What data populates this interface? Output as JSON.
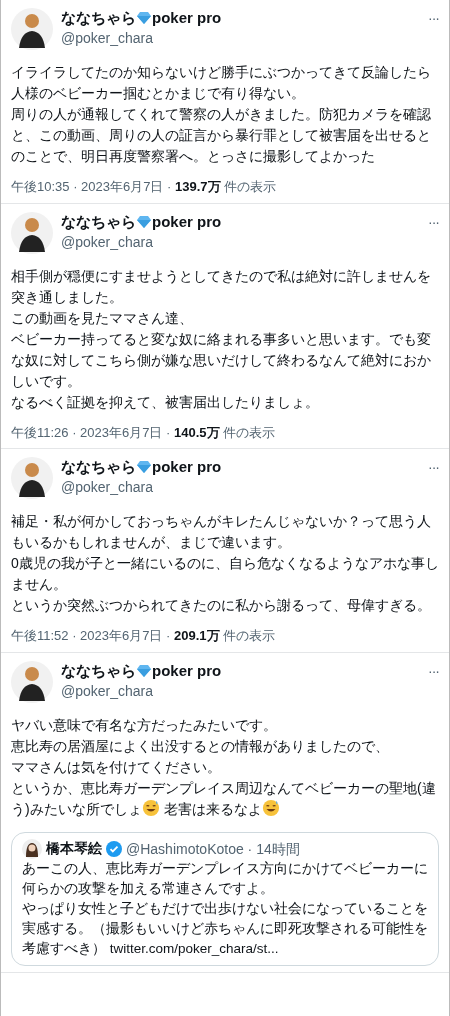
{
  "tweets": [
    {
      "name": "ななちゃら",
      "name_suffix": "poker pro",
      "handle": "@poker_chara",
      "more": "···",
      "paragraphs": [
        {
          "kind": "text",
          "text": "イライラしてたのか知らないけど勝手にぶつかってきて反論したら人様のベビーカー掴むとかまじで有り得ない。"
        },
        {
          "kind": "text",
          "text": "周りの人が通報してくれて警察の人がきました。防犯カメラを確認と、この動画、周りの人の証言から暴行罪として被害届を出せるとのことで、明日再度警察署へ。とっさに撮影してよかった"
        }
      ],
      "meta": "午後10:35 · 2023年6月7日 · **139.7万** 件の表示"
    },
    {
      "name": "ななちゃら",
      "name_suffix": "poker pro",
      "handle": "@poker_chara",
      "more": "···",
      "paragraphs": [
        {
          "kind": "text",
          "text": "相手側が穏便にすませようとしてきたので私は絶対に許しませんを突き通しました。"
        },
        {
          "kind": "text",
          "text": "この動画を見たママさん達、"
        },
        {
          "kind": "text",
          "text": "ベビーカー持ってると変な奴に絡まれる事多いと思います。でも変な奴に対してこちら側が嫌な思いだけして終わるなんて絶対におかしいです。"
        },
        {
          "kind": "text",
          "text": "なるべく証拠を抑えて、被害届出したりましょ。"
        }
      ],
      "meta": "午後11:26 · 2023年6月7日 · **140.5万** 件の表示"
    },
    {
      "name": "ななちゃら",
      "name_suffix": "poker pro",
      "handle": "@poker_chara",
      "more": "···",
      "paragraphs": [
        {
          "kind": "text",
          "text": "補足・私が何かしておっちゃんがキレたんじゃないか？って思う人もいるかもしれませんが、まじで違います。"
        },
        {
          "kind": "text",
          "text": "0歳児の我が子と一緒にいるのに、自ら危なくなるようなアホな事しません。"
        },
        {
          "kind": "text",
          "text": "というか突然ぶつかられてきたのに私から謝るって、母偉すぎる。"
        }
      ],
      "meta": "午後11:52 · 2023年6月7日 · **209.1万** 件の表示"
    },
    {
      "name": "ななちゃら",
      "name_suffix": "poker pro",
      "handle": "@poker_chara",
      "more": "···",
      "paragraphs": [
        {
          "kind": "text",
          "text": "ヤバい意味で有名な方だったみたいです。"
        },
        {
          "kind": "text",
          "text": "恵比寿の居酒屋によく出没するとの情報がありましたので、"
        },
        {
          "kind": "text",
          "text": "ママさんは気を付けてください。"
        },
        {
          "kind": "mixed",
          "parts": [
            {
              "kind": "text",
              "text": "というか、恵比寿ガーデンプレイス周辺なんてベビーカーの聖地(違う)みたいな所でしょ"
            },
            {
              "kind": "emoji"
            },
            {
              "kind": "text",
              "text": " 老害は来るなよ"
            },
            {
              "kind": "emoji"
            }
          ]
        }
      ],
      "quote": {
        "name": "橋本琴絵",
        "verified": true,
        "handle": "@HashimotoKotoe · 14時間",
        "paragraphs": [
          "あーこの人、恵比寿ガーデンプレイス方向にかけてベビーカーに何らかの攻撃を加える常連さんですよ。",
          "やっぱり女性と子どもだけで出歩けない社会になっていることを実感する。（撮影もいいけど赤ちゃんに即死攻撃される可能性を考慮すべき）"
        ],
        "link": "twitter.com/poker_chara/st..."
      }
    }
  ]
}
